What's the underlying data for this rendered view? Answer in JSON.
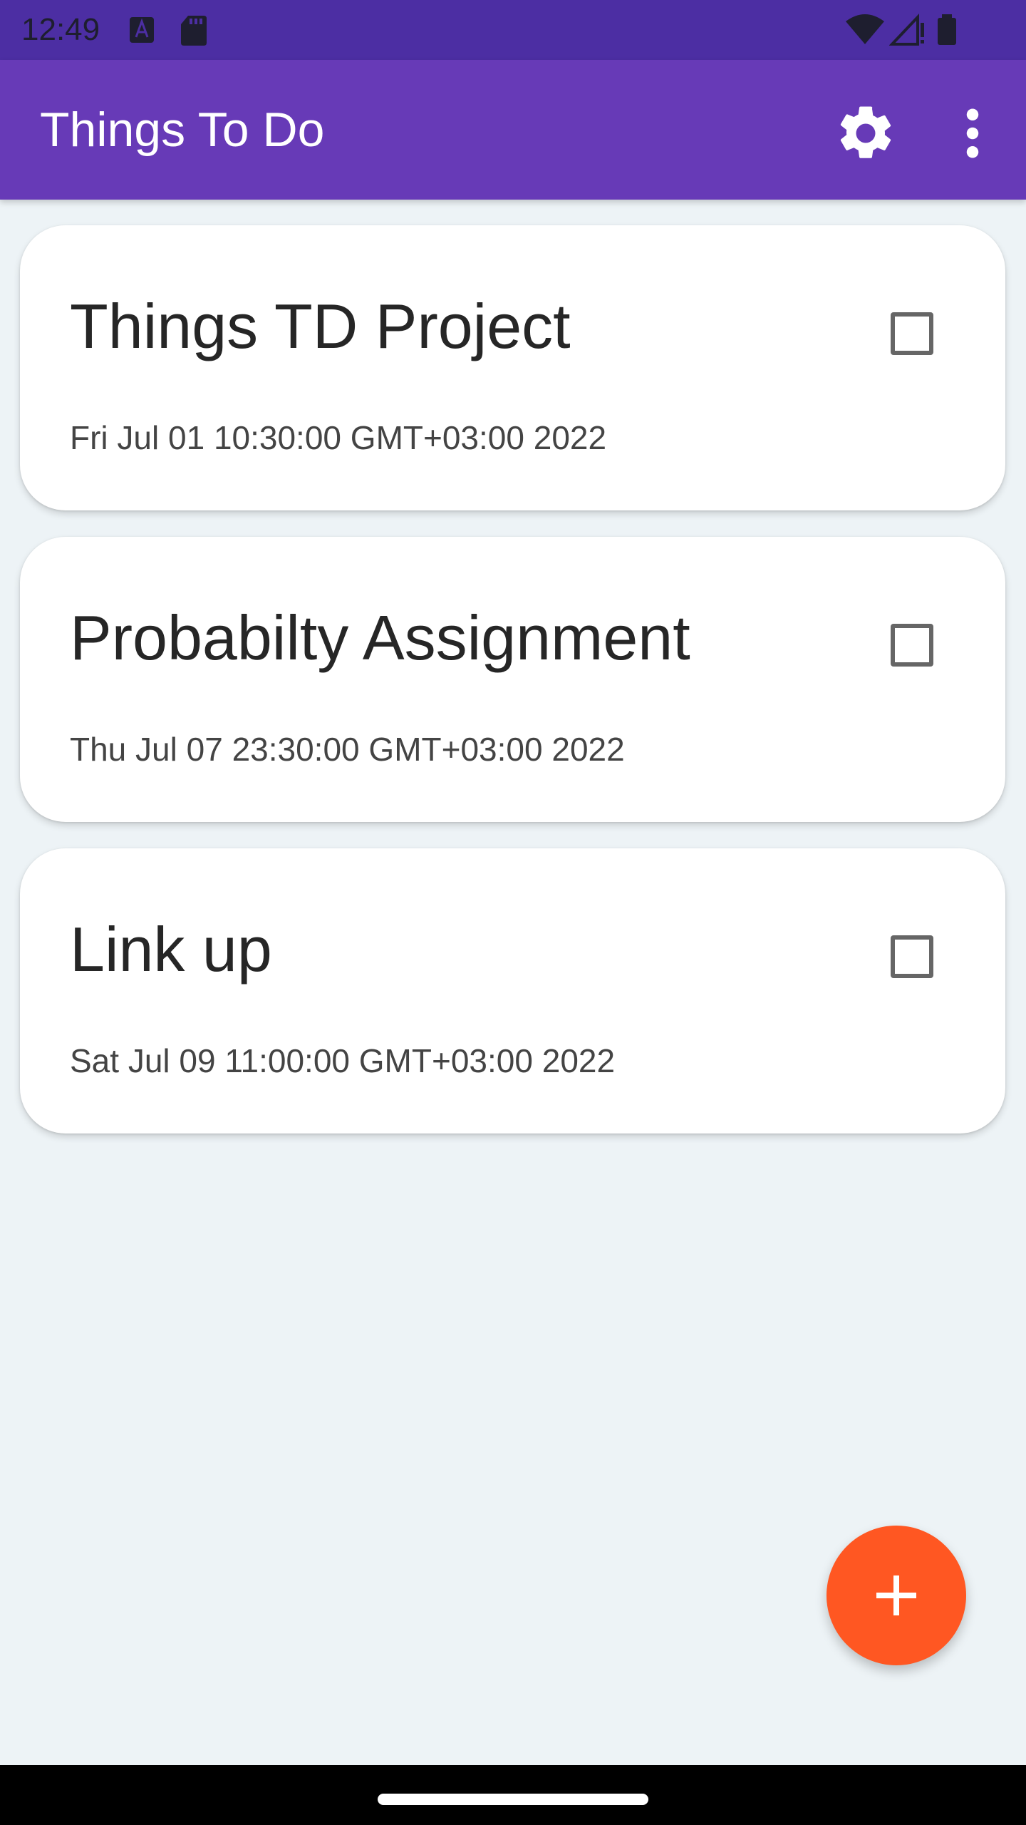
{
  "status_bar": {
    "time": "12:49",
    "icons": [
      "notification-icon",
      "sd-card-icon",
      "wifi-icon",
      "signal-icon",
      "battery-icon"
    ]
  },
  "app_bar": {
    "title": "Things To Do",
    "actions": [
      "settings-icon",
      "more-vert-icon"
    ]
  },
  "tasks": [
    {
      "title": "Things TD Project",
      "date": "Fri Jul 01 10:30:00 GMT+03:00 2022",
      "checked": false
    },
    {
      "title": "Probabilty Assignment",
      "date": "Thu Jul 07 23:30:00 GMT+03:00 2022",
      "checked": false
    },
    {
      "title": "Link up",
      "date": "Sat Jul 09 11:00:00 GMT+03:00 2022",
      "checked": false
    }
  ],
  "fab": {
    "icon": "plus-icon"
  },
  "colors": {
    "status_bar": "#4c2ea3",
    "app_bar": "#673ab7",
    "background": "#edf3f6",
    "fab": "#ff5722"
  }
}
